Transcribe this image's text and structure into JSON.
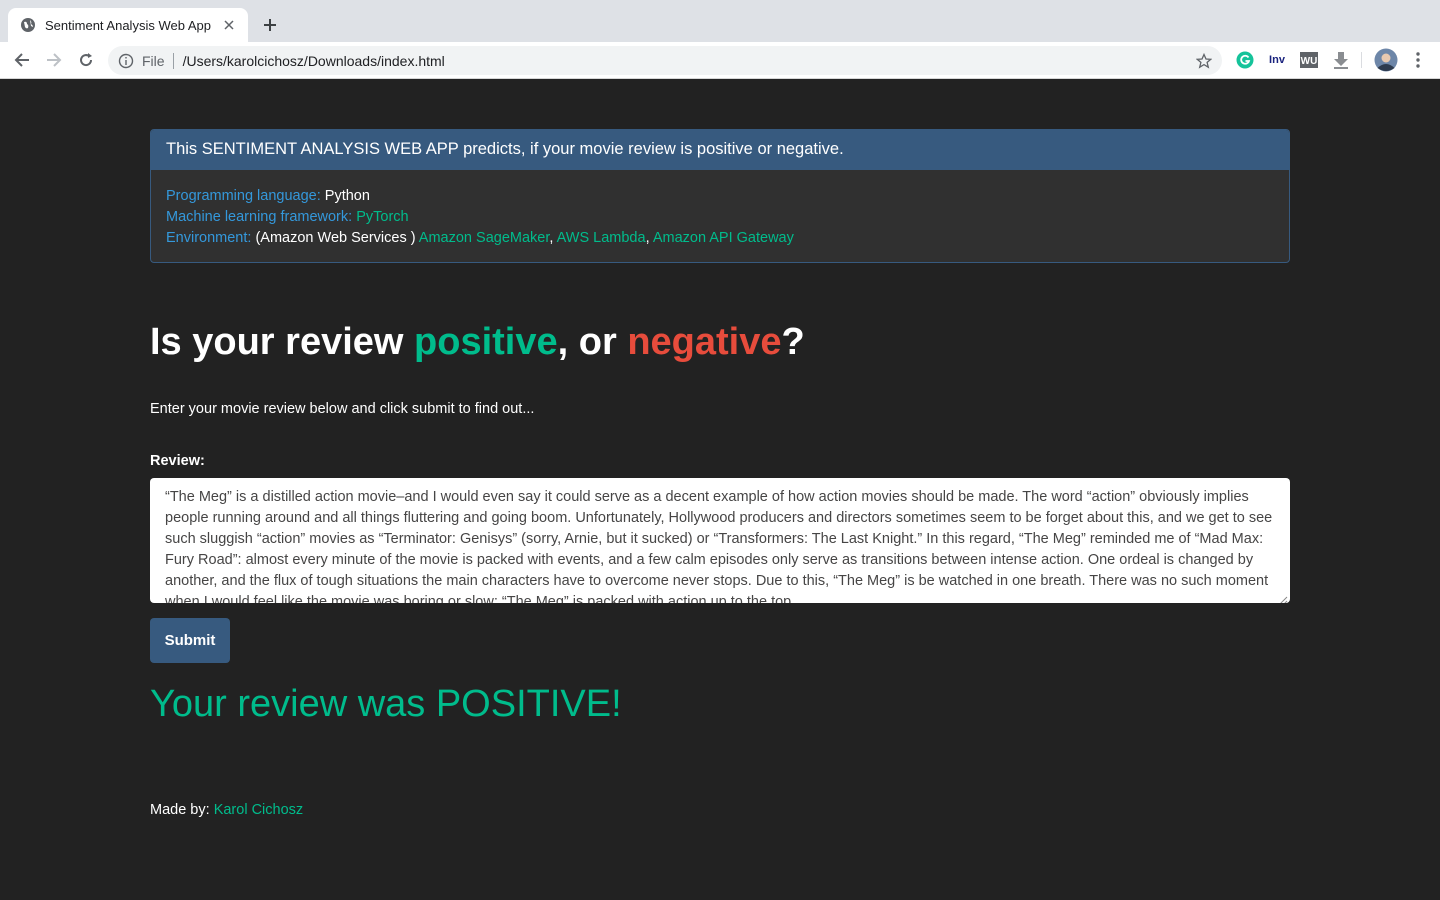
{
  "browser": {
    "tab_title": "Sentiment Analysis Web App",
    "scheme_label": "File",
    "url": "/Users/karolcichosz/Downloads/index.html",
    "extensions": {
      "inv_label": "Inv",
      "wu_label": "WU"
    }
  },
  "info_panel": {
    "heading": "This SENTIMENT ANALYSIS WEB APP predicts, if your movie review is positive or negative.",
    "language_label": "Programming language:",
    "language_value": "Python",
    "framework_label": "Machine learning framework:",
    "framework_value": "PyTorch",
    "environment_label": "Environment:",
    "environment_provider": "(Amazon Web Services )",
    "env_sagemaker": "Amazon SageMaker",
    "env_lambda": "AWS Lambda",
    "env_gateway": "Amazon API Gateway",
    "comma": ","
  },
  "main": {
    "heading_part1": "Is your review ",
    "heading_positive": "positive",
    "heading_part2": ", or ",
    "heading_negative": "negative",
    "heading_part3": "?",
    "subheading": "Enter your movie review below and click submit to find out...",
    "review_label": "Review:",
    "review_text": "“The Meg” is a distilled action movie–and I would even say it could serve as a decent example of how action movies should be made. The word “action” obviously implies people running around and all things fluttering and going boom. Unfortunately, Hollywood producers and directors sometimes seem to be forget about this, and we get to see such sluggish “action” movies as “Terminator: Genisys” (sorry, Arnie, but it sucked) or “Transformers: The Last Knight.” In this regard, “The Meg” reminded me of “Mad Max: Fury Road”: almost every minute of the movie is packed with events, and a few calm episodes only serve as transitions between intense action. One ordeal is changed by another, and the flux of tough situations the main characters have to overcome never stops. Due to this, “The Meg” is be watched in one breath. There was no such moment when I would feel like the movie was boring or slow; “The Meg” is packed with action up to the top.",
    "submit_label": "Submit",
    "result": "Your review was POSITIVE!"
  },
  "footer": {
    "made_by_label": "Made by:",
    "author": "Karol Cichosz"
  },
  "colors": {
    "background": "#222222",
    "panel_heading": "#375a7f",
    "label_blue": "#3498db",
    "accent_green": "#00bc8c",
    "negative_red": "#e74c3c"
  },
  "icons": [
    "globe-favicon-icon",
    "close-icon",
    "plus-icon",
    "back-arrow-icon",
    "forward-arrow-icon",
    "reload-icon",
    "info-icon",
    "star-icon",
    "grammarly-icon",
    "download-icon",
    "profile-avatar",
    "menu-dots-icon"
  ]
}
